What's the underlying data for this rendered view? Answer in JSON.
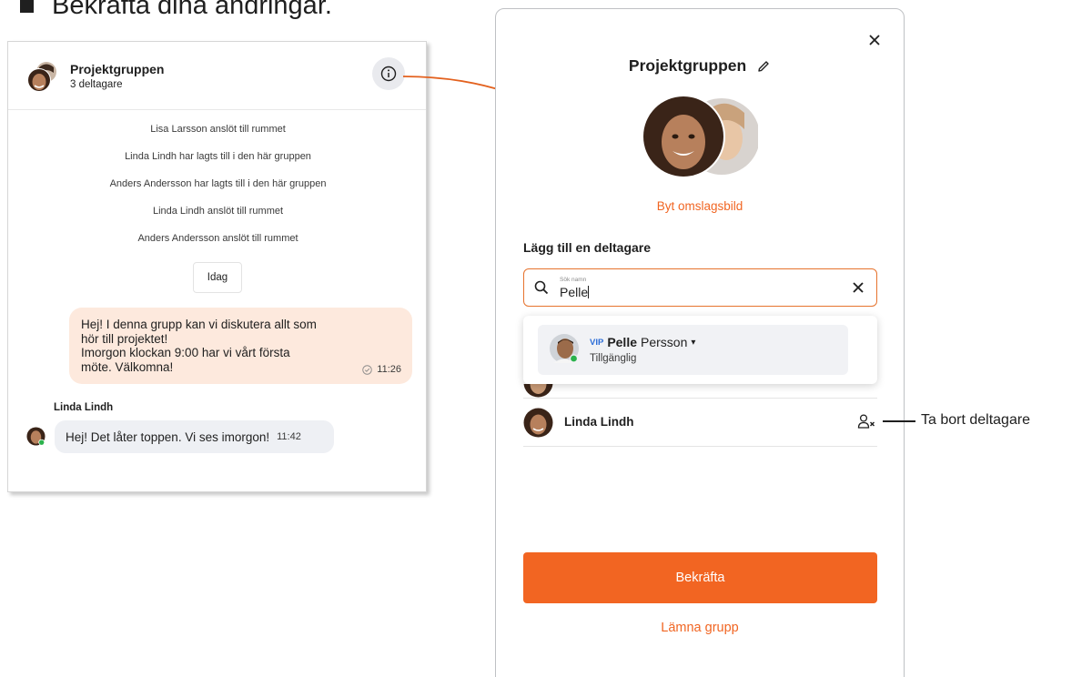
{
  "heading": {
    "text": "Bekräfta dina ändringar."
  },
  "chat": {
    "title": "Projektgruppen",
    "subtitle": "3 deltagare",
    "system_messages": [
      "Lisa Larsson anslöt till rummet",
      "Linda Lindh har lagts till i den här gruppen",
      "Anders Andersson har lagts till i den här gruppen",
      "Linda Lindh anslöt till rummet",
      "Anders Andersson anslöt till rummet"
    ],
    "day_label": "Idag",
    "outgoing": {
      "lines": [
        "Hej! I denna grupp kan vi diskutera allt som",
        "hör till projektet!",
        "Imorgon klockan 9:00 har vi vårt första",
        "möte. Välkomna!"
      ],
      "time": "11:26"
    },
    "incoming": {
      "sender": "Linda Lindh",
      "text": "Hej! Det låter toppen. Vi ses imorgon!",
      "time": "11:42"
    }
  },
  "panel": {
    "title": "Projektgruppen",
    "change_cover": "Byt omslagsbild",
    "add_participant_label": "Lägg till en deltagare",
    "search": {
      "placeholder": "Sök namn",
      "value": "Pelle"
    },
    "result": {
      "badge": "VIP",
      "first_name": "Pelle",
      "last_name": "Persson",
      "caret": "▾",
      "status": "Tillgänglig"
    },
    "members": [
      {
        "name": "Linda Lindh"
      }
    ],
    "confirm_label": "Bekräfta",
    "leave_label": "Lämna grupp"
  },
  "annotations": {
    "remove_participant": "Ta bort deltagare"
  },
  "colors": {
    "accent": "#f26522",
    "bubble_out": "#fde9dd",
    "bubble_in": "#eef0f4",
    "vip": "#2e6fd8",
    "online": "#2bb24c"
  }
}
